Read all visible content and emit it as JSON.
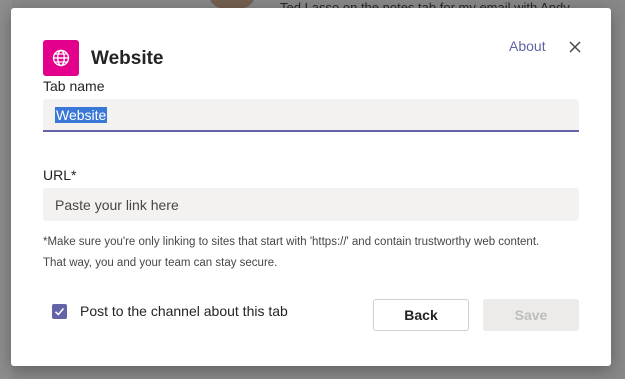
{
  "background": {
    "text": "Ted Lasso on the notes tab for my email with Andy"
  },
  "dialog": {
    "title": "Website",
    "about_label": "About",
    "icon": "globe-icon",
    "close_icon": "close-icon",
    "accent_color": "#6264a7",
    "icon_bg_color": "#e3008c"
  },
  "form": {
    "tab_name_label": "Tab name",
    "tab_name_value": "Website",
    "url_label": "URL*",
    "url_placeholder": "Paste your link here",
    "note_line1": "*Make sure you're only linking to sites that start with 'https://' and contain trustworthy web content.",
    "note_line2": "That way, you and your team can stay secure.",
    "post_checkbox_label": "Post to the channel about this tab",
    "post_checkbox_checked": true
  },
  "buttons": {
    "back_label": "Back",
    "save_label": "Save"
  }
}
